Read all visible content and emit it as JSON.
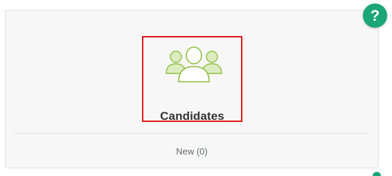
{
  "card": {
    "tile": {
      "label": "Candidates",
      "icon": "users-group-icon",
      "icon_colors": {
        "stroke": "#8cbf3f",
        "fill_light": "#dcecc0",
        "fill_center": "#ffffff"
      },
      "highlight_color": "#e01414"
    },
    "footer": {
      "link_label": "New (0)"
    }
  },
  "help_button": {
    "label": "?",
    "icon": "question-icon",
    "color": "#1aa677"
  }
}
